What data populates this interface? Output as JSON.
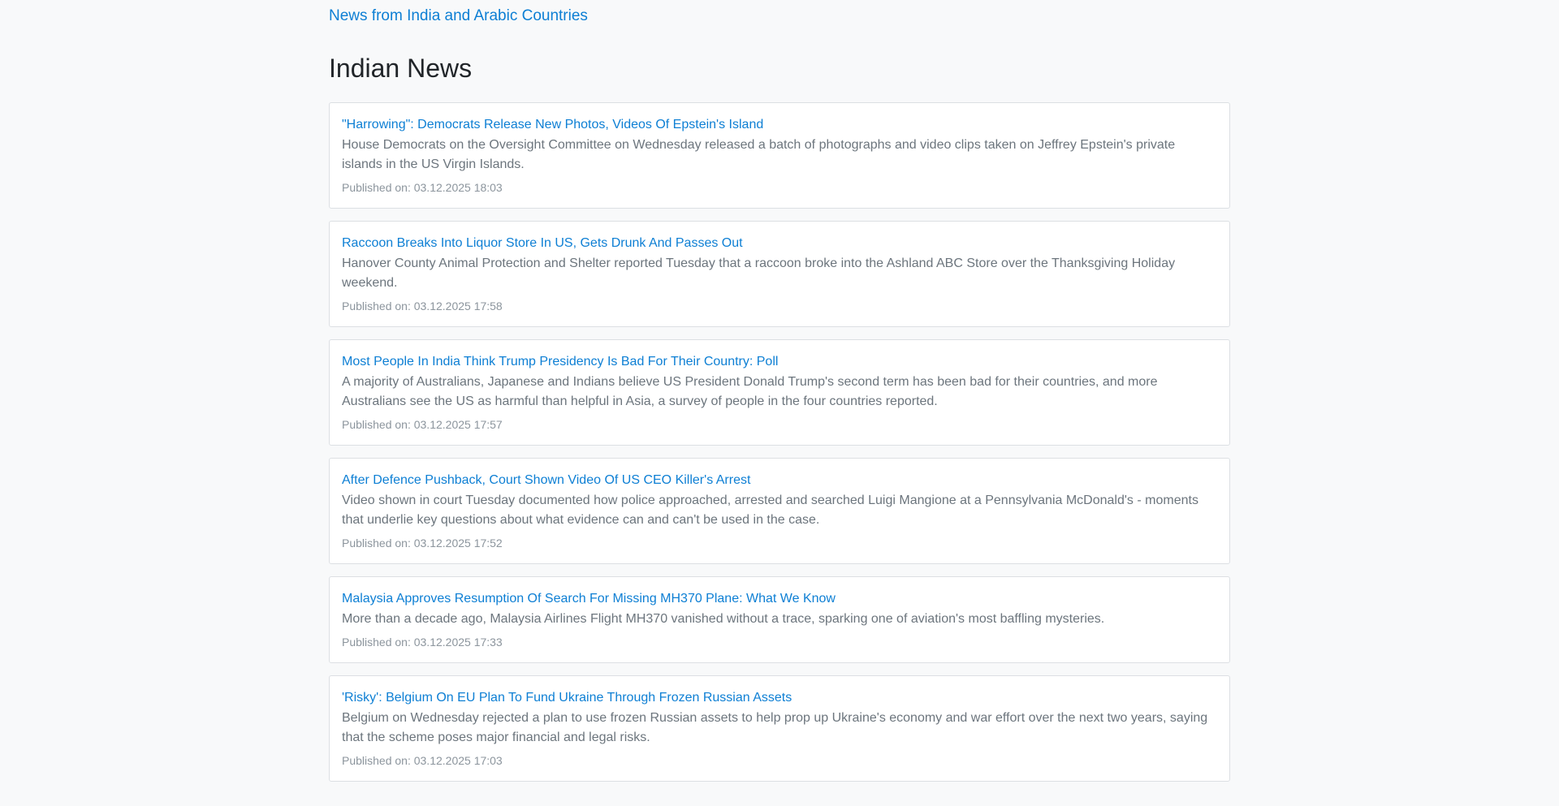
{
  "site_link": "News from India and Arabic Countries",
  "section_title": "Indian News",
  "articles": [
    {
      "title": "\"Harrowing\": Democrats Release New Photos, Videos Of Epstein's Island",
      "description": "House Democrats on the Oversight Committee on Wednesday released a batch of photographs and video clips taken on Jeffrey Epstein's private islands in the US Virgin Islands.",
      "published": "Published on: 03.12.2025 18:03"
    },
    {
      "title": "Raccoon Breaks Into Liquor Store In US, Gets Drunk And Passes Out",
      "description": "Hanover County Animal Protection and Shelter reported Tuesday that a raccoon broke into the Ashland ABC Store over the Thanksgiving Holiday weekend.",
      "published": "Published on: 03.12.2025 17:58"
    },
    {
      "title": "Most People In India Think Trump Presidency Is Bad For Their Country: Poll",
      "description": "A majority of Australians, Japanese and Indians believe US President Donald Trump's second term has been bad for their countries, and more Australians see the US as harmful than helpful in Asia, a survey of people in the four countries reported.",
      "published": "Published on: 03.12.2025 17:57"
    },
    {
      "title": "After Defence Pushback, Court Shown Video Of US CEO Killer's Arrest",
      "description": "Video shown in court Tuesday documented how police approached, arrested and searched Luigi Mangione at a Pennsylvania McDonald's - moments that underlie key questions about what evidence can and can't be used in the case.",
      "published": "Published on: 03.12.2025 17:52"
    },
    {
      "title": "Malaysia Approves Resumption Of Search For Missing MH370 Plane: What We Know",
      "description": "More than a decade ago, Malaysia Airlines Flight MH370 vanished without a trace, sparking one of aviation's most baffling mysteries.",
      "published": "Published on: 03.12.2025 17:33"
    },
    {
      "title": "'Risky': Belgium On EU Plan To Fund Ukraine Through Frozen Russian Assets",
      "description": "Belgium on Wednesday rejected a plan to use frozen Russian assets to help prop up Ukraine's economy and war effort over the next two years, saying that the scheme poses major financial and legal risks.",
      "published": "Published on: 03.12.2025 17:03"
    }
  ]
}
